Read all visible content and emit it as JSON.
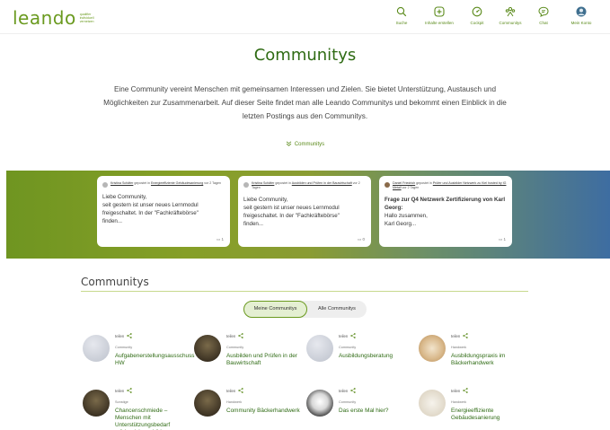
{
  "header": {
    "logo_text": "leando",
    "logo_tagline": "qualifier individuell vernetzen",
    "nav": [
      {
        "label": "Suche",
        "icon": "search-icon"
      },
      {
        "label": "Inhalte erstellen",
        "icon": "plus-circle-icon"
      },
      {
        "label": "Cockpit",
        "icon": "gauge-icon"
      },
      {
        "label": "Communitys",
        "icon": "community-icon"
      },
      {
        "label": "Chat",
        "icon": "chat-icon"
      },
      {
        "label": "Mein Konto",
        "icon": "avatar-icon"
      }
    ]
  },
  "hero": {
    "title": "Communitys",
    "intro": "Eine Community vereint Menschen mit gemeinsamen Interessen und Zielen. Sie bietet Unterstützung, Austausch und Möglichkeiten zur Zusammenarbeit. Auf dieser Seite findet man alle Leando Communitys und bekommt einen Einblick in die letzten Postings aus den Communitys.",
    "anchor_label": "Communitys"
  },
  "posts": [
    {
      "author": "Kristina Schäfer",
      "posted_in": "gepostet in",
      "community": "Energieeffiziente Gebäudesanierung",
      "time": "vor 2 Tagen",
      "lines": [
        "Liebe Community,",
        "seit gestern ist unser neues Lernmodul",
        "freigeschaltet. In der \"Fachkräftebörse\"",
        "finden..."
      ],
      "comments": "1"
    },
    {
      "author": "Kristina Schäfer",
      "posted_in": "gepostet in",
      "community": "Ausbilden und Prüfen in der Bauwirtschaft",
      "time": "vor 2 Tagen",
      "lines": [
        "Liebe Community,",
        "seit gestern ist unser neues Lernmodul",
        "freigeschaltet. In der \"Fachkräftebörse\"",
        "finden..."
      ],
      "comments": "0"
    },
    {
      "author": "Daniel Friedrich",
      "posted_in": "gepostet in",
      "community": "Prüfer und Ausbilder Netzwerk zu Kiel hosted by IG Metall",
      "time": "vor 2 Tagen",
      "headline": "Frage zur Q4 Netzwerk Zertifizierung von Karl Georg:",
      "lines": [
        "Hallo zusammen,",
        "Karl Georg..."
      ],
      "comments": "1"
    }
  ],
  "communities": {
    "section_title": "Communitys",
    "tabs": [
      "Meine Communitys",
      "Alle Communitys"
    ],
    "share_label": "teilen",
    "items": [
      {
        "category": "Community",
        "name": "Aufgabenerstellungsausschuss HW"
      },
      {
        "category": "Community",
        "name": "Ausbilden und Prüfen in der Bauwirtschaft"
      },
      {
        "category": "Community",
        "name": "Ausbildungsberatung"
      },
      {
        "category": "Handwerk",
        "name": "Ausbildungspraxis im Bäckerhandwerk"
      },
      {
        "category": "Sonstige",
        "name": "Chancenschmiede – Menschen mit Unterstützungsbedarf erfolgreich ausbilden"
      },
      {
        "category": "Handwerk",
        "name": "Community Bäckerhandwerk"
      },
      {
        "category": "Community",
        "name": "Das erste Mal hier?"
      },
      {
        "category": "Handwerk",
        "name": "Energieeffiziente Gebäudesanierung"
      }
    ]
  },
  "colors": {
    "brand_green": "#6a9a1f",
    "dark_green": "#2f6b14",
    "banner_blue": "#3e6da1"
  }
}
